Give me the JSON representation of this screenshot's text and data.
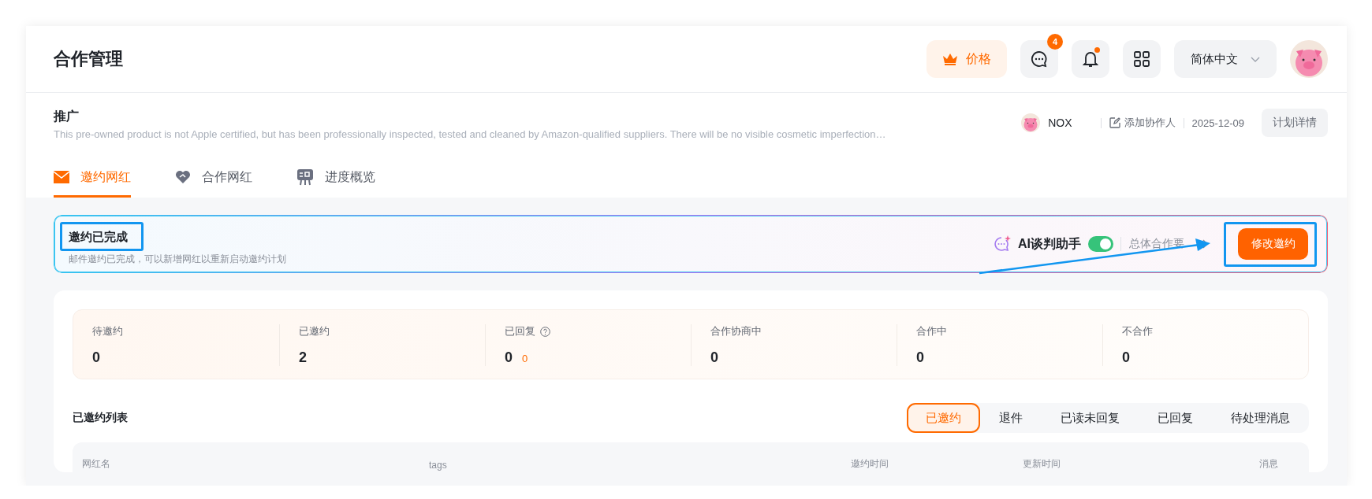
{
  "header": {
    "title": "合作管理",
    "price_label": "价格",
    "messages_badge": "4",
    "bell_unread": true,
    "language": "简体中文"
  },
  "plan": {
    "name": "推广",
    "description": "This pre-owned product is not Apple certified, but has been professionally inspected, tested and cleaned by Amazon-qualified suppliers. There will be no visible cosmetic imperfection…",
    "owner": "NOX",
    "add_collaborator": "添加协作人",
    "date": "2025-12-09",
    "details_button": "计划详情"
  },
  "tabs": [
    {
      "label": "邀约网红",
      "selected": true,
      "kind": "mail"
    },
    {
      "label": "合作网红",
      "selected": false,
      "kind": "heart"
    },
    {
      "label": "进度概览",
      "selected": false,
      "kind": "board"
    }
  ],
  "banner": {
    "title": "邀约已完成",
    "subtitle": "邮件邀约已完成，可以新增网红以重新启动邀约计划",
    "assistant_label": "AI谈判助手",
    "assistant_on": true,
    "requirements_link": "总体合作要",
    "edit_button": "修改邀约"
  },
  "stats": [
    {
      "label": "待邀约",
      "value": "0"
    },
    {
      "label": "已邀约",
      "value": "2"
    },
    {
      "label": "已回复",
      "value": "0",
      "extra": "0",
      "help": true
    },
    {
      "label": "合作协商中",
      "value": "0"
    },
    {
      "label": "合作中",
      "value": "0"
    },
    {
      "label": "不合作",
      "value": "0"
    }
  ],
  "list": {
    "title": "已邀约列表",
    "filters": [
      {
        "label": "已邀约",
        "selected": true
      },
      {
        "label": "退件",
        "selected": false
      },
      {
        "label": "已读未回复",
        "selected": false
      },
      {
        "label": "已回复",
        "selected": false
      },
      {
        "label": "待处理消息",
        "selected": false
      }
    ],
    "columns": [
      "网红名",
      "tags",
      "邀约时间",
      "更新时间",
      "消息"
    ]
  }
}
